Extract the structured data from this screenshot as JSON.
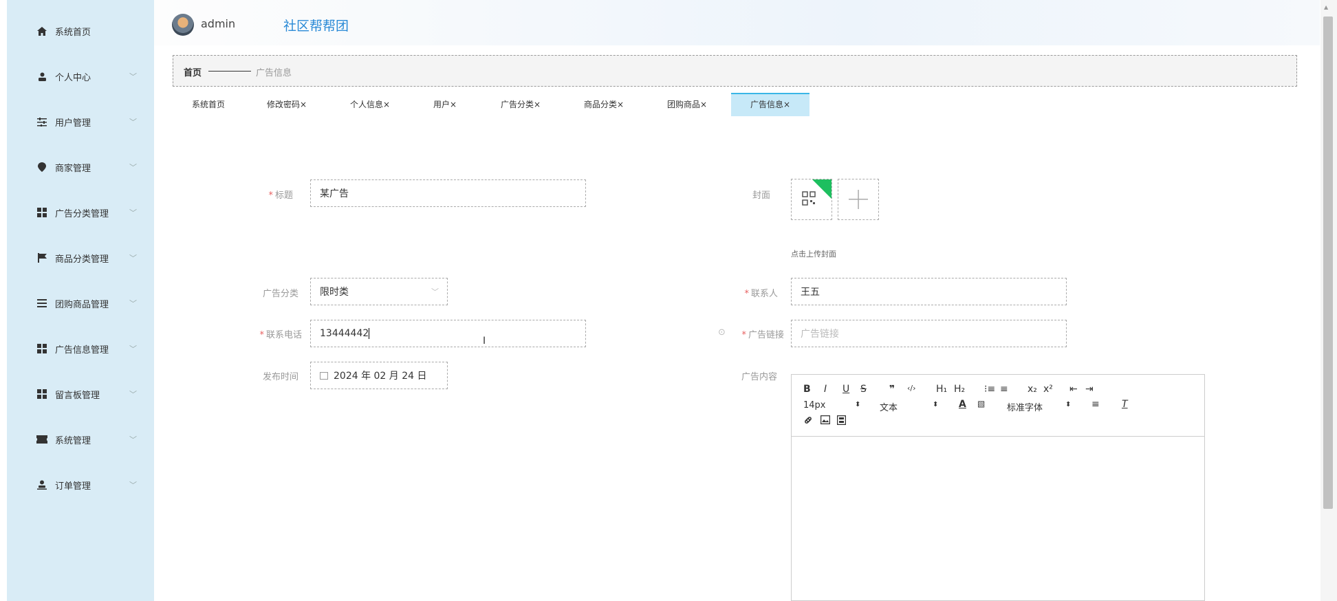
{
  "header": {
    "username": "admin",
    "app_title": "社区帮帮团"
  },
  "sidebar": {
    "items": [
      {
        "label": "系统首页",
        "icon": "home-icon",
        "chevron": ""
      },
      {
        "label": "个人中心",
        "icon": "user-icon",
        "chevron": "﹀"
      },
      {
        "label": "用户管理",
        "icon": "sliders-icon",
        "chevron": "﹀"
      },
      {
        "label": "商家管理",
        "icon": "location-icon",
        "chevron": "﹀"
      },
      {
        "label": "广告分类管理",
        "icon": "grid-icon",
        "chevron": "﹀"
      },
      {
        "label": "商品分类管理",
        "icon": "flag-icon",
        "chevron": "﹀"
      },
      {
        "label": "团购商品管理",
        "icon": "list-icon",
        "chevron": "﹀"
      },
      {
        "label": "广告信息管理",
        "icon": "grid-icon",
        "chevron": "﹀"
      },
      {
        "label": "留言板管理",
        "icon": "grid-icon",
        "chevron": "﹀"
      },
      {
        "label": "系统管理",
        "icon": "ticket-icon",
        "chevron": "﹀"
      },
      {
        "label": "订单管理",
        "icon": "user-icon",
        "chevron": "﹀"
      }
    ]
  },
  "breadcrumb": {
    "home": "首页",
    "current": "广告信息"
  },
  "tabs": [
    {
      "label": "系统首页"
    },
    {
      "label": "修改密码×"
    },
    {
      "label": "个人信息×"
    },
    {
      "label": "用户×"
    },
    {
      "label": "广告分类×"
    },
    {
      "label": "商品分类×"
    },
    {
      "label": "团购商品×"
    },
    {
      "label": "广告信息×",
      "active": true
    }
  ],
  "form": {
    "title": {
      "label": "标题",
      "required": "*",
      "value": "某广告"
    },
    "cover": {
      "label": "封面",
      "hint": "点击上传封面"
    },
    "category": {
      "label": "广告分类",
      "value": "限时类",
      "chevron": "﹀"
    },
    "contact": {
      "label": "联系人",
      "required": "*",
      "value": "王五"
    },
    "phone": {
      "label": "联系电话",
      "required": "*",
      "value": "13444442"
    },
    "link": {
      "label": "广告链接",
      "required": "*",
      "placeholder": "广告链接",
      "info_icon": "⊙"
    },
    "publish_time": {
      "label": "发布时间",
      "value": "2024 年 02 月 24 日"
    },
    "content": {
      "label": "广告内容"
    }
  },
  "editor": {
    "row1": [
      "B",
      "I",
      "U",
      "S",
      "❞",
      "‹/›",
      "H₁",
      "H₂",
      "⁝≡",
      "≡",
      "x₂",
      "x²",
      "⇤",
      "⇥"
    ],
    "font_size": "14px",
    "heading": "文本",
    "font_family": "标准字体",
    "select_arrow": "⬍"
  }
}
